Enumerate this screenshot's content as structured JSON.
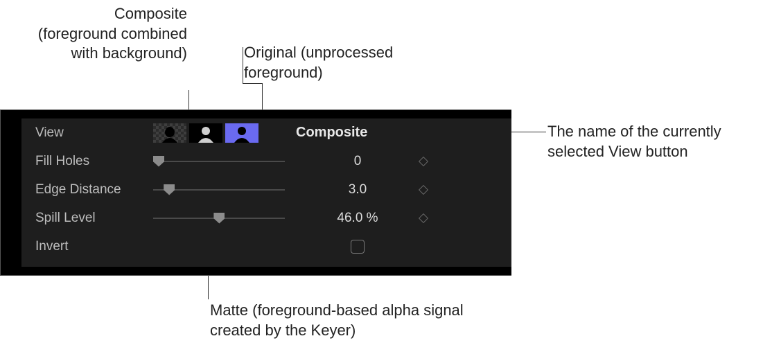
{
  "callouts": {
    "composite": "Composite (foreground combined with background)",
    "original": "Original (unprocessed foreground)",
    "view_name": "The name of the currently selected View button",
    "matte": "Matte (foreground-based alpha signal created by the Keyer)"
  },
  "panel": {
    "view": {
      "label": "View",
      "selected_name": "Composite",
      "buttons": {
        "composite": "composite-view",
        "matte": "matte-view",
        "original": "original-view"
      }
    },
    "fill_holes": {
      "label": "Fill Holes",
      "value": "0",
      "pos_pct": 0
    },
    "edge_distance": {
      "label": "Edge Distance",
      "value": "3.0",
      "pos_pct": 8
    },
    "spill_level": {
      "label": "Spill Level",
      "value": "46.0 %",
      "pos_pct": 46
    },
    "invert": {
      "label": "Invert",
      "checked": false
    }
  }
}
